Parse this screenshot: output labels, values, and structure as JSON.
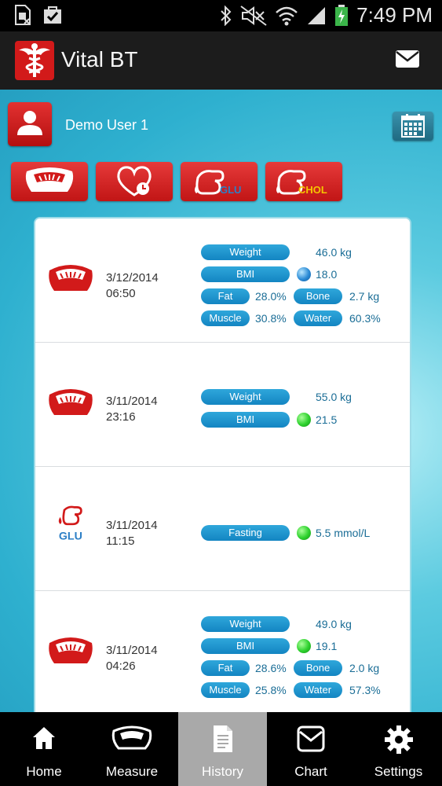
{
  "status_bar": {
    "time": "7:49 PM",
    "icons": [
      "sim-card-icon",
      "bag-check-icon",
      "bluetooth-icon",
      "mute-icon",
      "wifi-icon",
      "signal-icon",
      "battery-icon"
    ]
  },
  "app_bar": {
    "title": "Vital BT",
    "logo_icon": "caduceus-icon",
    "mail_icon": "mail-icon"
  },
  "user": {
    "name": "Demo User 1",
    "avatar_icon": "person-icon",
    "calendar_icon": "calendar-icon"
  },
  "categories": [
    {
      "name": "scale",
      "icon": "scale-icon"
    },
    {
      "name": "blood-pressure",
      "icon": "heart-clock-icon"
    },
    {
      "name": "glucose",
      "icon": "glucose-icon",
      "label": "GLU"
    },
    {
      "name": "cholesterol",
      "icon": "cholesterol-icon",
      "label": "CHOL"
    }
  ],
  "records": [
    {
      "type": "scale",
      "date": "3/12/2014",
      "time": "06:50",
      "weight_label": "Weight",
      "weight": "46.0 kg",
      "bmi_label": "BMI",
      "bmi": "18.0",
      "bmi_status": "blue",
      "fat_label": "Fat",
      "fat": "28.0%",
      "bone_label": "Bone",
      "bone": "2.7 kg",
      "muscle_label": "Muscle",
      "muscle": "30.8%",
      "water_label": "Water",
      "water": "60.3%"
    },
    {
      "type": "scale",
      "date": "3/11/2014",
      "time": "23:16",
      "weight_label": "Weight",
      "weight": "55.0 kg",
      "bmi_label": "BMI",
      "bmi": "21.5",
      "bmi_status": "green"
    },
    {
      "type": "glucose",
      "date": "3/11/2014",
      "time": "11:15",
      "icon_label": "GLU",
      "fasting_label": "Fasting",
      "fasting": "5.5 mmol/L",
      "fasting_status": "green"
    },
    {
      "type": "scale",
      "date": "3/11/2014",
      "time": "04:26",
      "weight_label": "Weight",
      "weight": "49.0 kg",
      "bmi_label": "BMI",
      "bmi": "19.1",
      "bmi_status": "green",
      "fat_label": "Fat",
      "fat": "28.6%",
      "bone_label": "Bone",
      "bone": "2.0 kg",
      "muscle_label": "Muscle",
      "muscle": "25.8%",
      "water_label": "Water",
      "water": "57.3%"
    }
  ],
  "nav": [
    {
      "label": "Home",
      "icon": "home-icon",
      "active": false
    },
    {
      "label": "Measure",
      "icon": "scale-icon",
      "active": false
    },
    {
      "label": "History",
      "icon": "document-icon",
      "active": true
    },
    {
      "label": "Chart",
      "icon": "chart-envelope-icon",
      "active": false
    },
    {
      "label": "Settings",
      "icon": "gear-icon",
      "active": false
    }
  ],
  "colors": {
    "brand_red": "#d21a1a",
    "pill_blue": "#1e93cf",
    "value_blue": "#1a6d96",
    "status_green": "#2dd12d",
    "status_blue": "#2b8bd6",
    "nav_active": "#a9a9a9"
  }
}
